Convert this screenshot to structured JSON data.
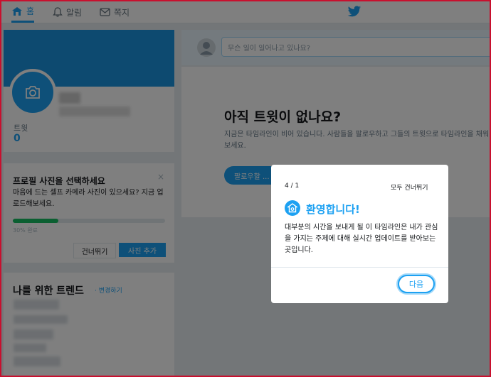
{
  "nav": {
    "home": "홈",
    "notifications": "알림",
    "messages": "쪽지"
  },
  "profile": {
    "tweets_label": "트윗",
    "tweets_count": "0"
  },
  "photo_prompt": {
    "title": "프로필 사진을 선택하세요",
    "close": "×",
    "description": "마음에 드는 셀프 카메라 사진이 있으세요? 지금 업로드해보세요.",
    "progress_percent": 30,
    "progress_label": "30% 완료",
    "skip_label": "건너뛰기",
    "add_label": "사진 추가"
  },
  "trends": {
    "title": "나를 위한 트렌드",
    "change": "· 변경하기"
  },
  "compose": {
    "placeholder": "무슨 일이 일어나고 있나요?"
  },
  "timeline": {
    "empty_title": "아직 트윗이 없나요?",
    "empty_desc": "지금은 타임라인이 비어 있습니다. 사람들을 팔로우하고 그들의 트윗으로 타임라인을 채워보세요.",
    "follow_button": "팔로우할 ..."
  },
  "modal": {
    "step": "4 / 1",
    "skip_all": "모두 건너뛰기",
    "title": "환영합니다!",
    "text": "대부분의 시간을 보내게 될 이 타임라인은 내가 관심을 가지는 주제에 대해 실시간 업데이트를 받아보는 곳입니다.",
    "next": "다음"
  },
  "colors": {
    "accent": "#1da1f2",
    "progress": "#17bf63",
    "frame": "#c8102e"
  }
}
